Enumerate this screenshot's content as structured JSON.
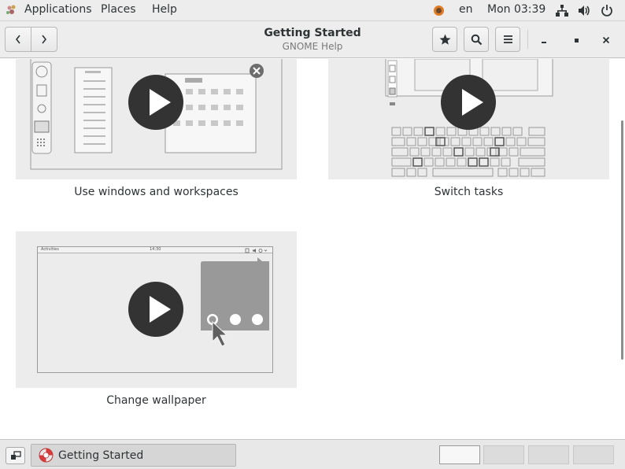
{
  "topbar": {
    "applications_label": "Applications",
    "places_label": "Places",
    "help_label": "Help",
    "keyboard_layout": "en",
    "clock": "Mon 03:39"
  },
  "headerbar": {
    "title": "Getting Started",
    "subtitle": "GNOME Help"
  },
  "videos": [
    {
      "caption": "Use windows and workspaces"
    },
    {
      "caption": "Switch tasks"
    },
    {
      "caption": "Change wallpaper"
    }
  ],
  "wallpaper_mock": {
    "activities_label": "Activities",
    "time_label": "14:30"
  },
  "taskbar": {
    "window_label": "Getting Started",
    "workspaces": [
      {
        "active": true
      },
      {
        "active": false
      },
      {
        "active": false
      },
      {
        "active": false
      }
    ]
  },
  "colors": {
    "panel": "#ededed",
    "card": "#ececec",
    "play_circle": "#333333"
  }
}
